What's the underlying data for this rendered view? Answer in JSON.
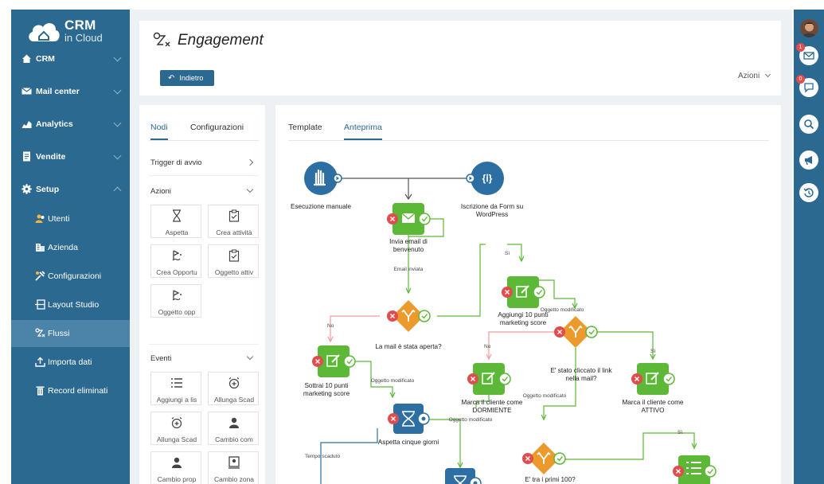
{
  "sidebar": {
    "logo": {
      "main": "CRM",
      "sub": "in Cloud"
    },
    "items": [
      {
        "label": "CRM",
        "icon": "home-icon"
      },
      {
        "label": "Mail center",
        "icon": "mail-icon"
      },
      {
        "label": "Analytics",
        "icon": "chart-icon"
      },
      {
        "label": "Vendite",
        "icon": "document-icon"
      },
      {
        "label": "Setup",
        "icon": "gear-icon"
      }
    ],
    "subitems": [
      {
        "label": "Utenti",
        "icon": "users-icon"
      },
      {
        "label": "Azienda",
        "icon": "building-icon"
      },
      {
        "label": "Configurazioni",
        "icon": "config-icon"
      },
      {
        "label": "Layout Studio",
        "icon": "layout-icon"
      },
      {
        "label": "Flussi",
        "icon": "flow-icon",
        "active": true
      },
      {
        "label": "Importa dati",
        "icon": "upload-icon"
      },
      {
        "label": "Record eliminati",
        "icon": "trash-icon"
      }
    ]
  },
  "header": {
    "title": "Engagement",
    "back": "Indietro",
    "actions": "Azioni"
  },
  "left_panel": {
    "tabs": [
      "Nodi",
      "Configurazioni"
    ],
    "trigger": "Trigger di avvio",
    "azioni": {
      "title": "Azioni",
      "tiles": [
        "Aspetta",
        "Crea attività",
        "Crea Opportu",
        "Oggetto attiv",
        "Oggetto opp"
      ]
    },
    "eventi": {
      "title": "Eventi",
      "tiles": [
        "Aggiungi a lis",
        "Allunga Scad",
        "Allunga Scad",
        "Cambio com",
        "Cambio prop",
        "Cambio zona"
      ]
    }
  },
  "canvas": {
    "tabs": [
      "Template",
      "Anteprima"
    ],
    "labels": {
      "manual": "Esecuzione manuale",
      "form1": "Iscrizione da Form su",
      "form2": "WordPress",
      "welcome1": "Invia email di",
      "welcome2": "benvenuto",
      "mail_sent": "Email inviata",
      "si1": "Sì",
      "add1": "Aggiungi 10 punti",
      "add2": "marketing score",
      "obj_mod1": "Oggetto modificato",
      "no1": "No",
      "opened": "La mail è stata aperta?",
      "no2": "No",
      "si2": "Sì",
      "clicked1": "E' stato cliccato il link",
      "clicked2": "nella mail?",
      "sub1": "Sottrai 10 punti",
      "sub2": "marketing score",
      "obj_mod2": "Oggetto modificato",
      "dorm1": "Marca il cliente come",
      "dorm2": "DORMIENTE",
      "obj_mod3": "Oggetto modificato",
      "att1": "Marca il cliente come",
      "att2": "ATTIVO",
      "wait": "Aspetta cinque giorni",
      "obj_mod4": "Oggetto modificato",
      "timeout": "Tempo scaduto",
      "first100": "E' tra i primi 100?",
      "si3": "Sì"
    }
  },
  "colors": {
    "sidebar": "#2b6991",
    "green": "#5cb836",
    "orange": "#ec9a2c",
    "blue_node": "#2d6fa3",
    "red_x": "#e14d4d"
  }
}
